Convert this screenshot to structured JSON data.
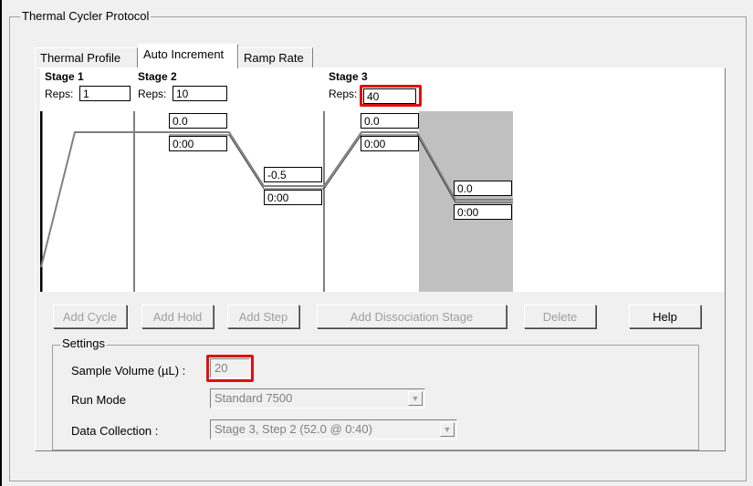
{
  "window": {
    "group_title": "Thermal Cycler Protocol"
  },
  "tabs": [
    {
      "label": "Thermal Profile",
      "active": false
    },
    {
      "label": "Auto Increment",
      "active": true
    },
    {
      "label": "Ramp Rate",
      "active": false
    }
  ],
  "stages": [
    {
      "title": "Stage 1",
      "reps_label": "Reps:",
      "reps": "1"
    },
    {
      "title": "Stage 2",
      "reps_label": "Reps:",
      "reps": "10"
    },
    {
      "title": "Stage 3",
      "reps_label": "Reps:",
      "reps": "40"
    }
  ],
  "steps": [
    {
      "temp": "0.0",
      "time": "0:00"
    },
    {
      "temp": "-0.5",
      "time": "0:00"
    },
    {
      "temp": "0.0",
      "time": "0:00"
    },
    {
      "temp": "0.0",
      "time": "0:00"
    }
  ],
  "buttons": {
    "add_cycle": "Add Cycle",
    "add_hold": "Add Hold",
    "add_step": "Add Step",
    "add_dissociation": "Add Dissociation Stage",
    "delete": "Delete",
    "help": "Help"
  },
  "settings": {
    "title": "Settings",
    "sample_volume_label": "Sample Volume (µL) :",
    "sample_volume": "20",
    "run_mode_label": "Run Mode",
    "run_mode": "Standard 7500",
    "data_collection_label": "Data Collection :",
    "data_collection": "Stage 3, Step 2 (52.0 @ 0:40)"
  },
  "icons": {
    "dropdown": "chevron-down-icon"
  },
  "colors": {
    "highlight": "#e01010",
    "selected_step": "#c0c0c0"
  }
}
